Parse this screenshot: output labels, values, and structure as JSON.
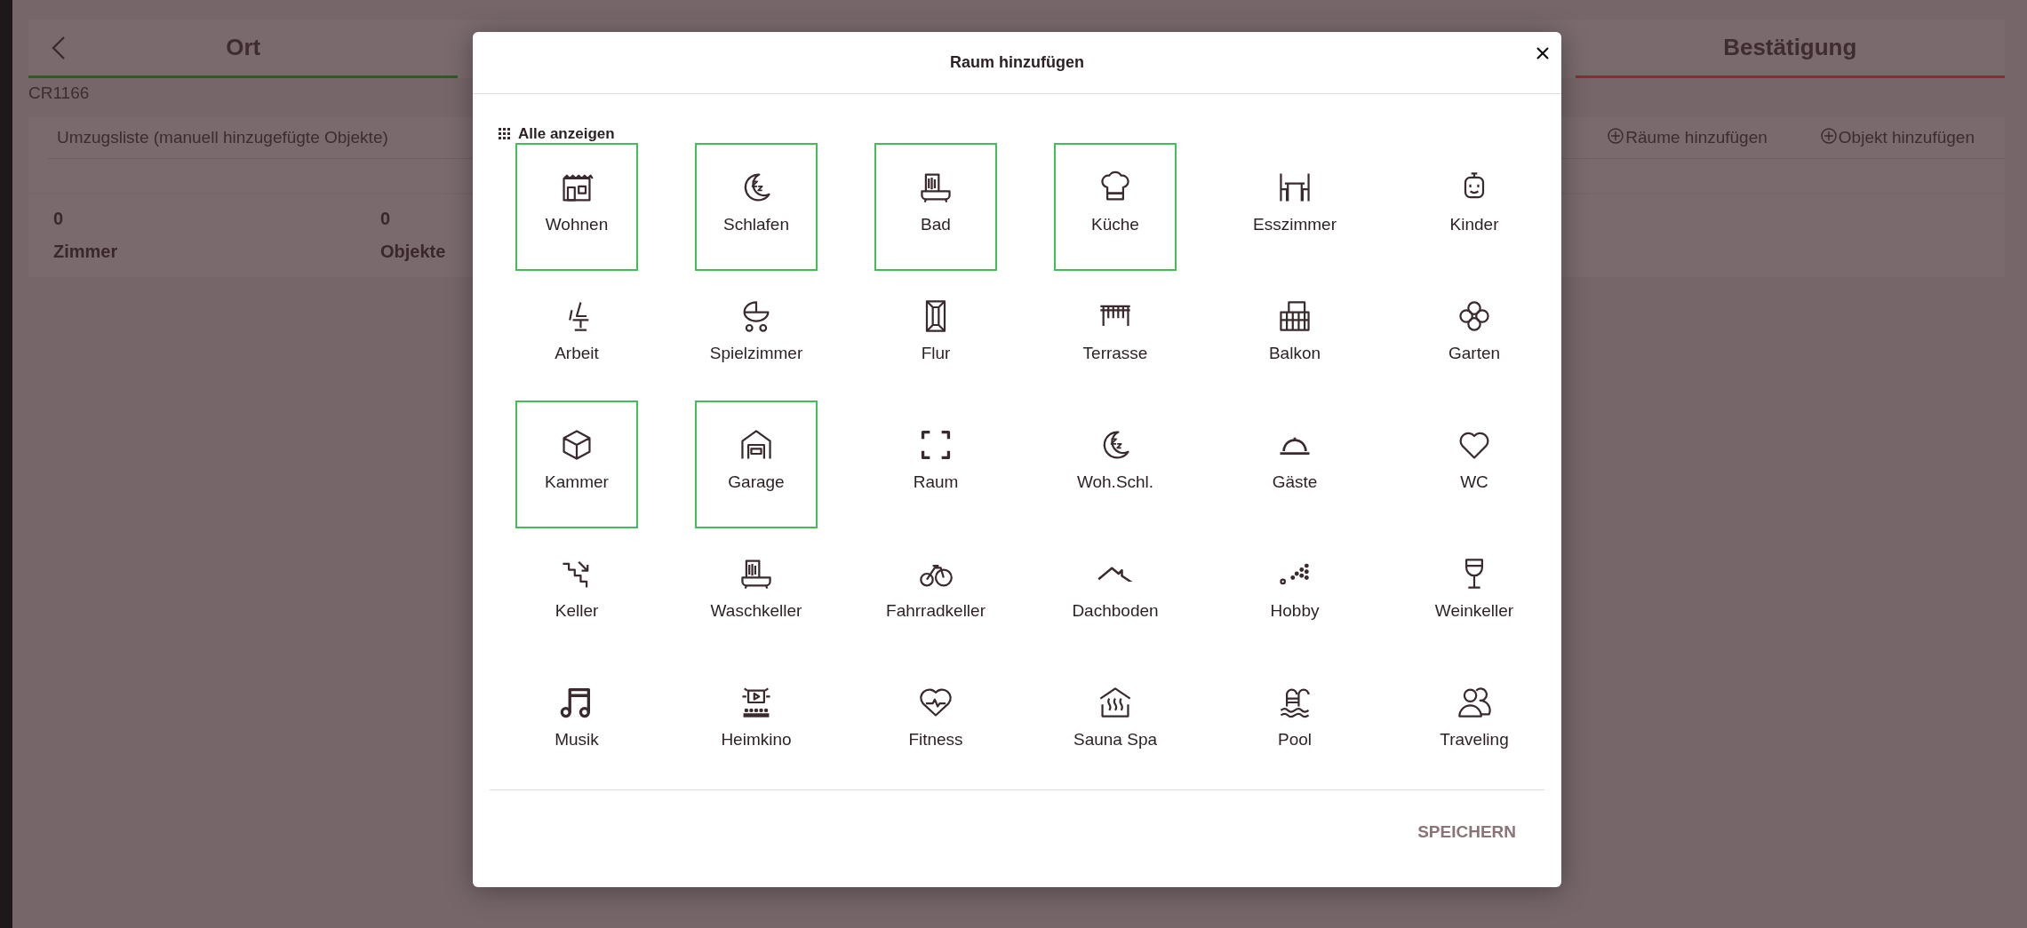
{
  "background": {
    "header": {
      "steps": [
        {
          "label": "Ort",
          "color": "#2f5a22"
        },
        {
          "label": "Bestätigung",
          "color": "#8e2a30"
        }
      ]
    },
    "reference": "CR1166",
    "list": {
      "title": "Umzugsliste (manuell hinzugefügte Objekte)",
      "actions": [
        "Räume hinzufügen",
        "Objekt hinzufügen"
      ],
      "stats": [
        {
          "value": "0",
          "label": "Zimmer"
        },
        {
          "value": "0",
          "label": "Objekte"
        }
      ]
    }
  },
  "dialog": {
    "title": "Raum hinzufügen",
    "show_all": "Alle anzeigen",
    "save_button": "SPEICHERN",
    "rooms": [
      {
        "label": "Wohnen",
        "selected": true
      },
      {
        "label": "Schlafen",
        "selected": true
      },
      {
        "label": "Bad",
        "selected": true
      },
      {
        "label": "Küche",
        "selected": true
      },
      {
        "label": "Esszimmer",
        "selected": false
      },
      {
        "label": "Kinder",
        "selected": false
      },
      {
        "label": "Arbeit",
        "selected": false
      },
      {
        "label": "Spielzimmer",
        "selected": false
      },
      {
        "label": "Flur",
        "selected": false
      },
      {
        "label": "Terrasse",
        "selected": false
      },
      {
        "label": "Balkon",
        "selected": false
      },
      {
        "label": "Garten",
        "selected": false
      },
      {
        "label": "Kammer",
        "selected": true
      },
      {
        "label": "Garage",
        "selected": true
      },
      {
        "label": "Raum",
        "selected": false
      },
      {
        "label": "Woh.Schl.",
        "selected": false
      },
      {
        "label": "Gäste",
        "selected": false
      },
      {
        "label": "WC",
        "selected": false
      },
      {
        "label": "Keller",
        "selected": false
      },
      {
        "label": "Waschkeller",
        "selected": false
      },
      {
        "label": "Fahrradkeller",
        "selected": false
      },
      {
        "label": "Dachboden",
        "selected": false
      },
      {
        "label": "Hobby",
        "selected": false
      },
      {
        "label": "Weinkeller",
        "selected": false
      },
      {
        "label": "Musik",
        "selected": false
      },
      {
        "label": "Heimkino",
        "selected": false
      },
      {
        "label": "Fitness",
        "selected": false
      },
      {
        "label": "Sauna Spa",
        "selected": false
      },
      {
        "label": "Pool",
        "selected": false
      },
      {
        "label": "Traveling",
        "selected": false
      }
    ]
  }
}
